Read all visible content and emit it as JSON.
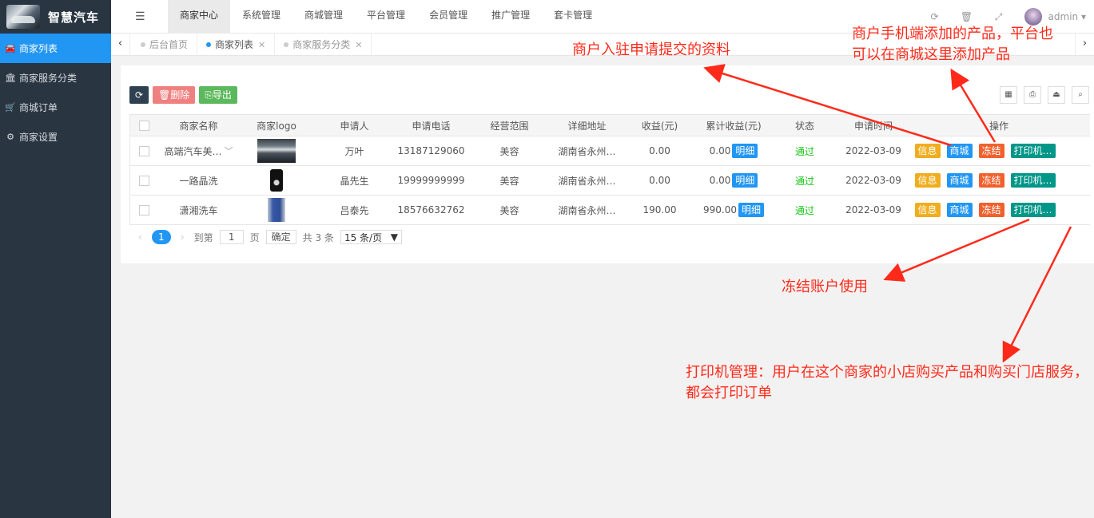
{
  "app": {
    "title": "智慧汽车"
  },
  "sidebar": {
    "items": [
      {
        "label": "商家列表",
        "icon": "car-icon"
      },
      {
        "label": "商家服务分类",
        "icon": "bank-icon"
      },
      {
        "label": "商城订单",
        "icon": "cart-icon"
      },
      {
        "label": "商家设置",
        "icon": "gear-icon"
      }
    ]
  },
  "topnav": {
    "items": [
      "商家中心",
      "系统管理",
      "商城管理",
      "平台管理",
      "会员管理",
      "推广管理",
      "套卡管理"
    ],
    "user": "admin"
  },
  "tabs": [
    {
      "label": "后台首页"
    },
    {
      "label": "商家列表"
    },
    {
      "label": "商家服务分类"
    }
  ],
  "toolbar": {
    "delete_label": "删除",
    "export_label": "导出"
  },
  "table": {
    "headers": [
      "商家名称",
      "商家logo",
      "申请人",
      "申请电话",
      "经营范围",
      "详细地址",
      "收益(元)",
      "累计收益(元)",
      "状态",
      "申请时间",
      "操作"
    ],
    "rows": [
      {
        "name": "高端汽车美…",
        "applicant": "万叶",
        "phone": "13187129060",
        "scope": "美容",
        "address": "湖南省永州…",
        "income": "0.00",
        "total": "0.00",
        "status": "通过",
        "time": "2022-03-09"
      },
      {
        "name": "一路晶洗",
        "applicant": "晶先生",
        "phone": "19999999999",
        "scope": "美容",
        "address": "湖南省永州…",
        "income": "0.00",
        "total": "0.00",
        "status": "通过",
        "time": "2022-03-09"
      },
      {
        "name": "潇湘洗车",
        "applicant": "吕泰先",
        "phone": "18576632762",
        "scope": "美容",
        "address": "湖南省永州…",
        "income": "190.00",
        "total": "990.00",
        "status": "通过",
        "time": "2022-03-09"
      }
    ],
    "detail_label": "明细",
    "actions": {
      "info": "信息",
      "mall": "商城",
      "freeze": "冻结",
      "print": "打印机…"
    }
  },
  "pager": {
    "current": "1",
    "goto_prefix": "到第",
    "page_input": "1",
    "page_suffix": "页",
    "confirm": "确定",
    "total": "共 3 条",
    "page_size": "15 条/页"
  },
  "annotations": {
    "a1": "商户入驻申请提交的资料",
    "a2": "商户手机端添加的产品，平台也可以在商城这里添加产品",
    "a3": "冻结账户使用",
    "a4": "打印机管理：用户在这个商家的小店购买产品和购买门店服务，都会打印订单"
  },
  "colors": {
    "sidebar_bg": "#2a3542",
    "accent": "#2196f3",
    "annotation": "#ff2a1a",
    "status_ok": "#18c418"
  }
}
